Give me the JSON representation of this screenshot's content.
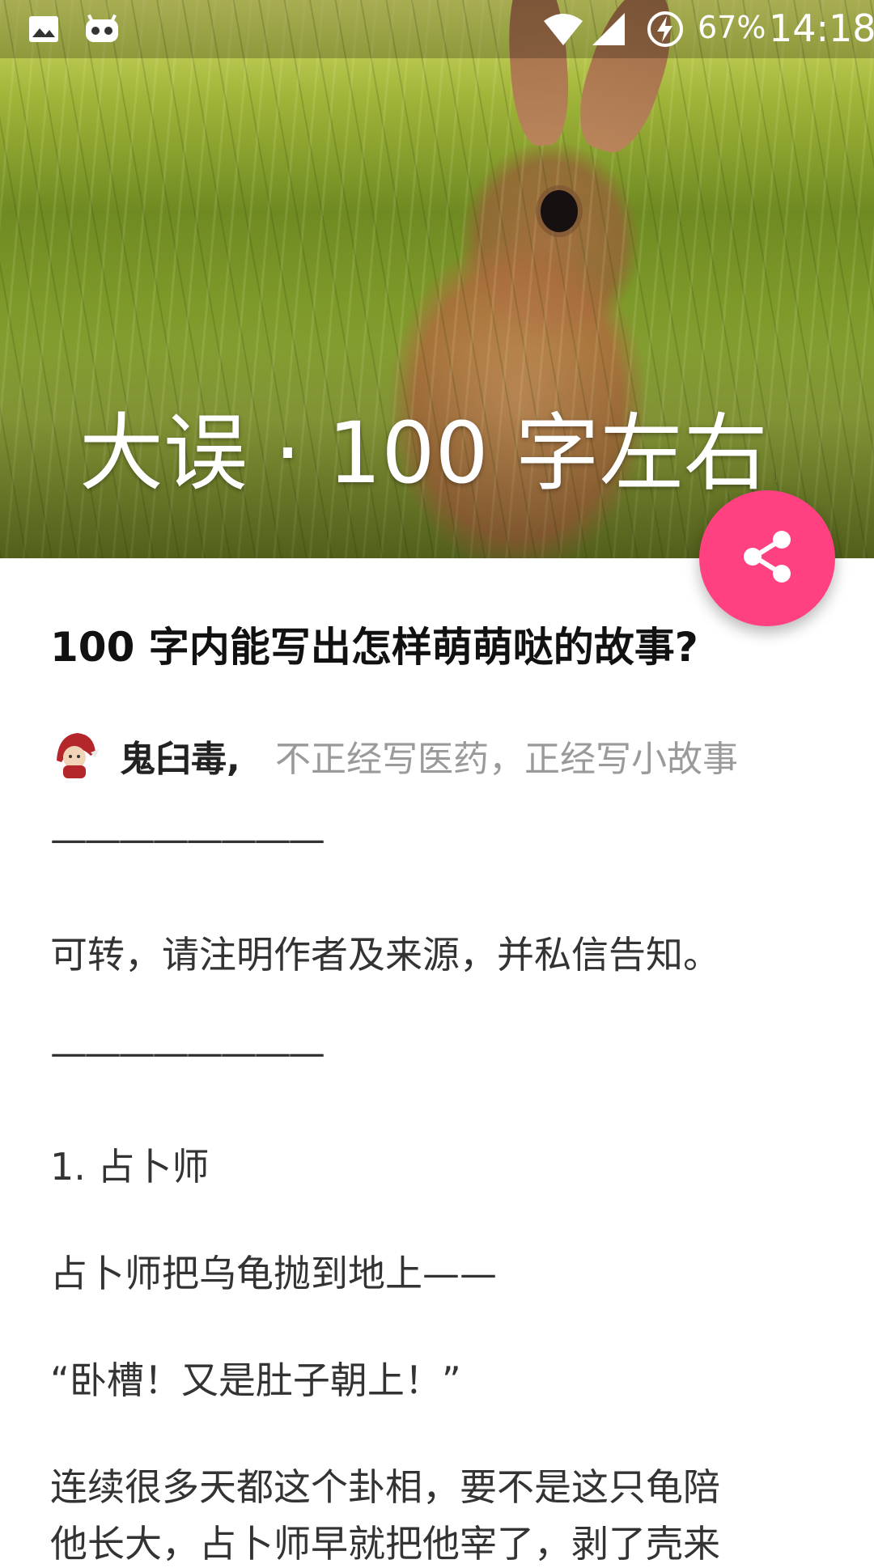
{
  "status_bar": {
    "battery_percent": "67%",
    "time": "14:18"
  },
  "header": {
    "title": "大误 · 100 字左右..."
  },
  "fab": {
    "icon": "share-icon",
    "color": "#ff4081"
  },
  "article": {
    "question_title": "100 字内能写出怎样萌萌哒的故事?",
    "author": {
      "name": "鬼臼毒,",
      "bio": "不正经写医药，正经写小故事"
    },
    "paragraphs": [
      "————————",
      "可转，请注明作者及来源，并私信告知。",
      "————————",
      "1. 占卜师",
      "占卜师把乌龟抛到地上——",
      "“卧槽！又是肚子朝上！”",
      "连续很多天都这个卦相，要不是这只龟陪",
      "他长大，占卜师早就把他宰了，剥了壳来"
    ]
  }
}
